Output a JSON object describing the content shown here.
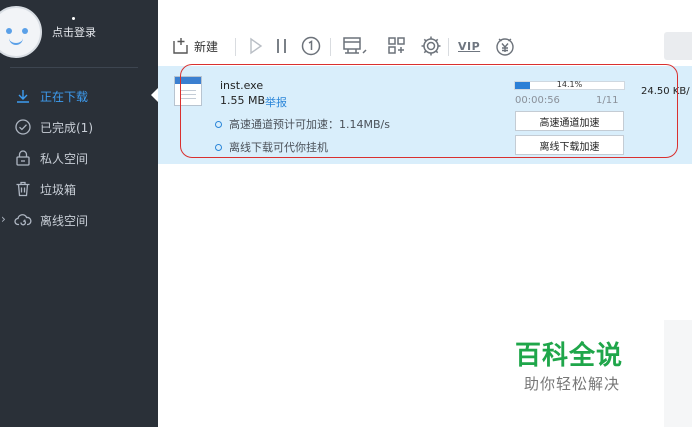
{
  "sidebar": {
    "login_label": "点击登录",
    "items": [
      {
        "label": "正在下载",
        "icon": "download-icon"
      },
      {
        "label": "已完成(1)",
        "icon": "check-circle-icon"
      },
      {
        "label": "私人空间",
        "icon": "lock-icon"
      },
      {
        "label": "垃圾箱",
        "icon": "trash-icon"
      },
      {
        "label": "离线空间",
        "icon": "cloud-refresh-icon"
      }
    ]
  },
  "toolbar": {
    "new_label": "新建",
    "vip_label": "VIP"
  },
  "task": {
    "file_name": "inst.exe",
    "file_size": "1.55 MB",
    "report_label": "举报",
    "progress_label": "14.1%",
    "progress": 0.141,
    "elapsed": "00:00:56",
    "pieces": "1/11",
    "speed": "24.50 KB/",
    "info_high_speed": "高速通道预计可加速：1.14MB/s",
    "info_offline": "离线下载可代你挂机",
    "btn_high_speed": "高速通道加速",
    "btn_offline": "离线下载加速"
  },
  "watermark": {
    "title": "百科全说",
    "subtitle": "助你轻松解决"
  },
  "colors": {
    "sidebar_bg": "#2a3038",
    "accent": "#3d9cf0",
    "task_row_bg": "#d9eefb",
    "highlight": "#d9302f",
    "watermark_green": "#1fa64a"
  }
}
